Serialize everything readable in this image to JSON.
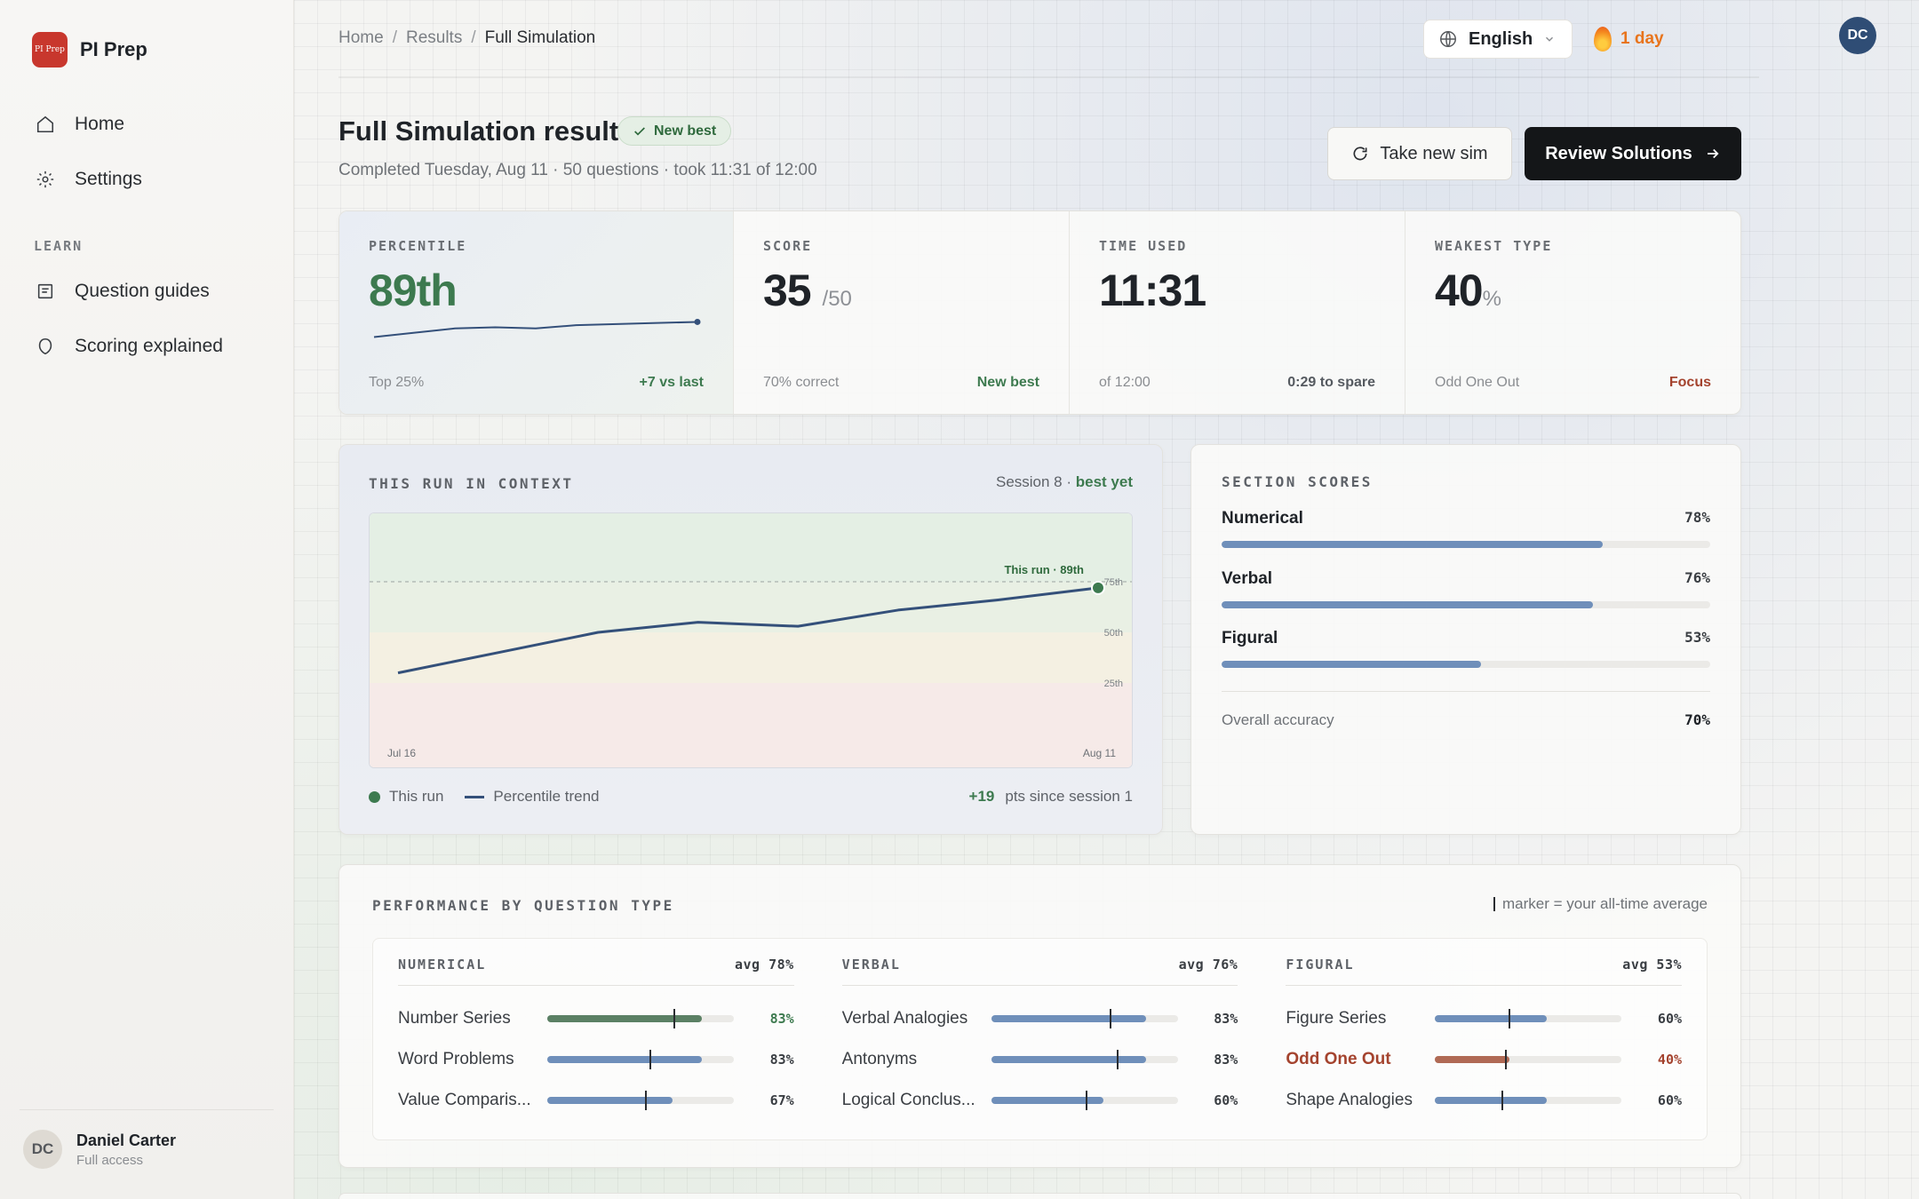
{
  "app": {
    "logo_text": "PI Prep",
    "name": "PI Prep"
  },
  "sidebar": {
    "nav": [
      {
        "label": "Home",
        "icon": "home-icon"
      },
      {
        "label": "Settings",
        "icon": "gear-icon"
      }
    ],
    "learn_heading": "LEARN",
    "learn": [
      {
        "label": "Question guides",
        "icon": "document-icon"
      },
      {
        "label": "Scoring explained",
        "icon": "shield-icon"
      }
    ],
    "user": {
      "initials": "DC",
      "name": "Daniel Carter",
      "plan": "Full access"
    }
  },
  "topbar": {
    "breadcrumb": [
      "Home",
      "Results",
      "Full Simulation"
    ],
    "language": "English",
    "streak": "1 day",
    "avatar_initials": "DC"
  },
  "header": {
    "title": "Full Simulation results",
    "badge": "New best",
    "subtitle": "Completed Tuesday, Aug 11 · 50 questions · took 11:31 of 12:00",
    "take_new_sim": "Take new sim",
    "review_solutions": "Review Solutions"
  },
  "stats": {
    "percentile": {
      "label": "PERCENTILE",
      "value": "89th",
      "foot_left": "Top 25%",
      "foot_right": "+7 vs last",
      "sparkline": [
        62,
        66,
        70,
        71,
        70,
        73,
        74,
        75,
        76
      ]
    },
    "score": {
      "label": "SCORE",
      "value": "35",
      "unit": "/50",
      "foot_left": "70% correct",
      "foot_right": "New best"
    },
    "time": {
      "label": "TIME USED",
      "value": "11:31",
      "foot_left": "of 12:00",
      "foot_right": "0:29 to spare"
    },
    "weakest": {
      "label": "WEAKEST TYPE",
      "value": "40",
      "unit": "%",
      "foot_left": "Odd One Out",
      "foot_right": "Focus"
    }
  },
  "context": {
    "label": "THIS RUN IN CONTEXT",
    "meta_prefix": "Session 8 · ",
    "meta_bold": "best yet",
    "legend_this_run": "This run",
    "legend_trend": "Percentile trend",
    "delta": "+19",
    "delta_suffix": "pts since session 1"
  },
  "chart_data": {
    "type": "line",
    "x": [
      "Jul 16",
      "",
      "",
      "",
      "",
      "",
      "",
      "Aug 11"
    ],
    "x_tick_labels": [
      "Jul 16",
      "Aug 11"
    ],
    "series": [
      {
        "values": [
          30,
          40,
          50,
          55,
          53,
          61,
          66,
          72
        ]
      }
    ],
    "ylim": [
      0,
      100
    ],
    "reference_lines": [
      {
        "label": "75th",
        "value": 75
      },
      {
        "label": "50th",
        "value": 50
      },
      {
        "label": "25th",
        "value": 25
      }
    ],
    "highlight": {
      "label": "This run · 89th",
      "index": 7
    }
  },
  "sections": {
    "label": "SECTION SCORES",
    "items": [
      {
        "name": "Numerical",
        "pct_label": "78%",
        "value": 78
      },
      {
        "name": "Verbal",
        "pct_label": "76%",
        "value": 76
      },
      {
        "name": "Figural",
        "pct_label": "53%",
        "value": 53
      }
    ],
    "overall_label": "Overall accuracy",
    "overall_value": "70%"
  },
  "performance": {
    "label": "PERFORMANCE BY QUESTION TYPE",
    "note": "marker = your all-time average",
    "columns": [
      {
        "name": "NUMERICAL",
        "avg": "avg 78%",
        "rows": [
          {
            "name": "Number Series",
            "pct": "83%",
            "value": 83,
            "avg": 68,
            "tone": "green"
          },
          {
            "name": "Word Problems",
            "pct": "83%",
            "value": 83,
            "avg": 55,
            "tone": "blue"
          },
          {
            "name": "Value Comparis...",
            "pct": "67%",
            "value": 67,
            "avg": 53,
            "tone": "blue"
          }
        ]
      },
      {
        "name": "VERBAL",
        "avg": "avg 76%",
        "rows": [
          {
            "name": "Verbal Analogies",
            "pct": "83%",
            "value": 83,
            "avg": 64,
            "tone": "blue"
          },
          {
            "name": "Antonyms",
            "pct": "83%",
            "value": 83,
            "avg": 68,
            "tone": "blue"
          },
          {
            "name": "Logical Conclus...",
            "pct": "60%",
            "value": 60,
            "avg": 51,
            "tone": "blue"
          }
        ]
      },
      {
        "name": "FIGURAL",
        "avg": "avg 53%",
        "rows": [
          {
            "name": "Figure Series",
            "pct": "60%",
            "value": 60,
            "avg": 40,
            "tone": "blue"
          },
          {
            "name": "Odd One Out",
            "pct": "40%",
            "value": 40,
            "avg": 38,
            "tone": "red"
          },
          {
            "name": "Shape Analogies",
            "pct": "60%",
            "value": 60,
            "avg": 36,
            "tone": "blue"
          }
        ]
      }
    ]
  },
  "colors": {
    "accent_green": "#3d7a4f",
    "bar_blue": "#6f8fba",
    "weak_red": "#a4432e",
    "line_navy": "#34507a",
    "brand_red": "#c8372d"
  }
}
